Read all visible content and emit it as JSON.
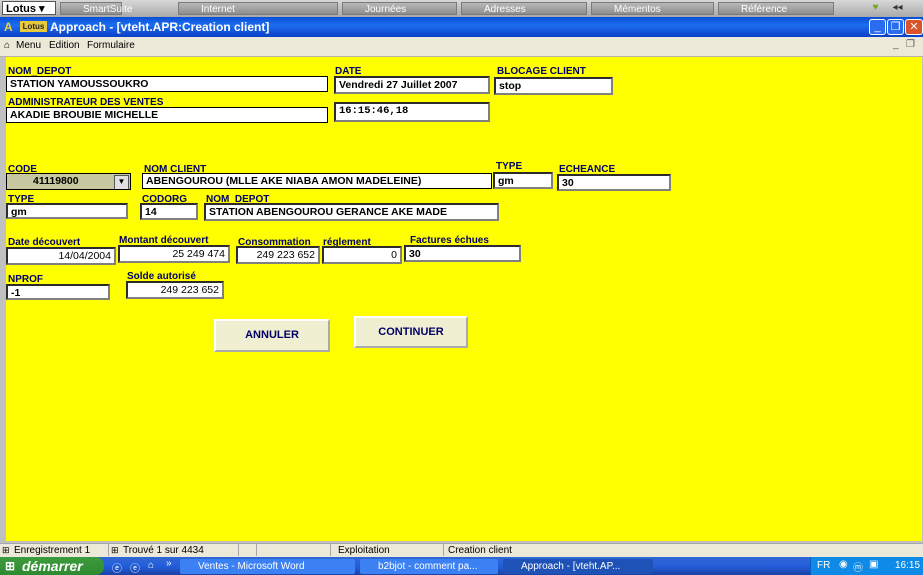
{
  "smartsuite": {
    "lotus_label": "Lotus",
    "tabs": [
      "SmartSuite",
      "Internet",
      "Journées",
      "Adresses",
      "Mémentos",
      "Référence"
    ]
  },
  "window": {
    "title": "Approach - [vteht.APR:Creation client]",
    "logo": "Lotus SMARTSuite"
  },
  "menu": {
    "items": [
      "Menu",
      "Edition",
      "Formulaire"
    ]
  },
  "form": {
    "nom_depot_label": "NOM_DEPOT",
    "nom_depot_value": "STATION YAMOUSSOUKRO",
    "date_label": "DATE",
    "date_value": "Vendredi 27 Juillet 2007",
    "blocage_label": "BLOCAGE CLIENT",
    "blocage_value": "stop",
    "admin_label": "ADMINISTRATEUR DES VENTES",
    "admin_value": "AKADIE  BROUBIE MICHELLE",
    "time_value": "16:15:46,18",
    "code_label": "CODE",
    "code_value": "41119800",
    "nom_client_label": "NOM CLIENT",
    "nom_client_value": "ABENGOUROU (MLLE AKE NIABA AMON MADELEINE)",
    "type_label": "TYPE",
    "type_value": "gm",
    "echeance_label": "ECHEANCE",
    "echeance_value": "30",
    "type2_label": "TYPE",
    "type2_value": "gm",
    "codorg_label": "CODORG",
    "codorg_value": "14",
    "nom_depot2_label": "NOM_DEPOT",
    "nom_depot2_value": "STATION ABENGOUROU GERANCE AKE MADE",
    "date_decouvert_label": "Date découvert",
    "date_decouvert_value": "14/04/2004",
    "montant_label": "Montant découvert",
    "montant_value": "25 249 474",
    "consommation_label": "Consommation",
    "consommation_value": "249 223 652",
    "reglement_label": "réglement",
    "reglement_value": "0",
    "factures_label": "Factures échues",
    "factures_value": "30",
    "nprof_label": "NPROF",
    "nprof_value": "-1",
    "solde_label": "Solde autorisé",
    "solde_value": "249 223 652",
    "annuler_label": "ANNULER",
    "continuer_label": "CONTINUER"
  },
  "status": {
    "record": "Enregistrement 1",
    "found": "Trouvé 1 sur 4434",
    "mode": "Exploitation",
    "view": "Creation client"
  },
  "taskbar": {
    "start": "démarrer",
    "tasks": [
      "Ventes - Microsoft Word",
      "b2bjot - comment pa...",
      "Approach - [vteht.AP..."
    ],
    "lang": "FR",
    "clock": "16:15"
  }
}
